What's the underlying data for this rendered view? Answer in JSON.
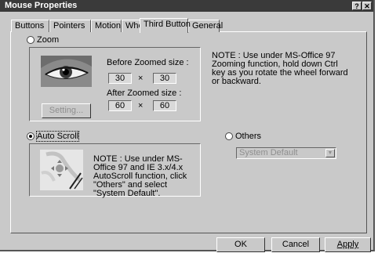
{
  "window": {
    "title": "Mouse Properties",
    "help_glyph": "?",
    "close_glyph": "✕"
  },
  "tabs": [
    {
      "label": "Buttons"
    },
    {
      "label": "Pointers"
    },
    {
      "label": "Motion"
    },
    {
      "label": "Wheel"
    },
    {
      "label": "Third Button",
      "active": true
    },
    {
      "label": "General"
    }
  ],
  "zoom": {
    "option_label": "Zoom",
    "selected": false,
    "before_label": "Before Zoomed size :",
    "before_width": "30",
    "before_height": "30",
    "after_label": "After Zoomed size :",
    "after_width": "60",
    "after_height": "60",
    "times": "×",
    "setting_button": "Setting...",
    "note": "NOTE : Use under MS-Office 97 Zooming function, hold down Ctrl key as you rotate the wheel forward or backward."
  },
  "autoscroll": {
    "option_label": "Auto Scroll",
    "selected": true,
    "note": "NOTE : Use under MS-Office 97 and IE 3.x/4.x AutoScroll function, click \"Others\" and select \"System Default\"."
  },
  "others": {
    "option_label": "Others",
    "selected": false,
    "select_value": "System Default"
  },
  "footer": {
    "ok": "OK",
    "cancel": "Cancel",
    "apply": "Apply"
  }
}
